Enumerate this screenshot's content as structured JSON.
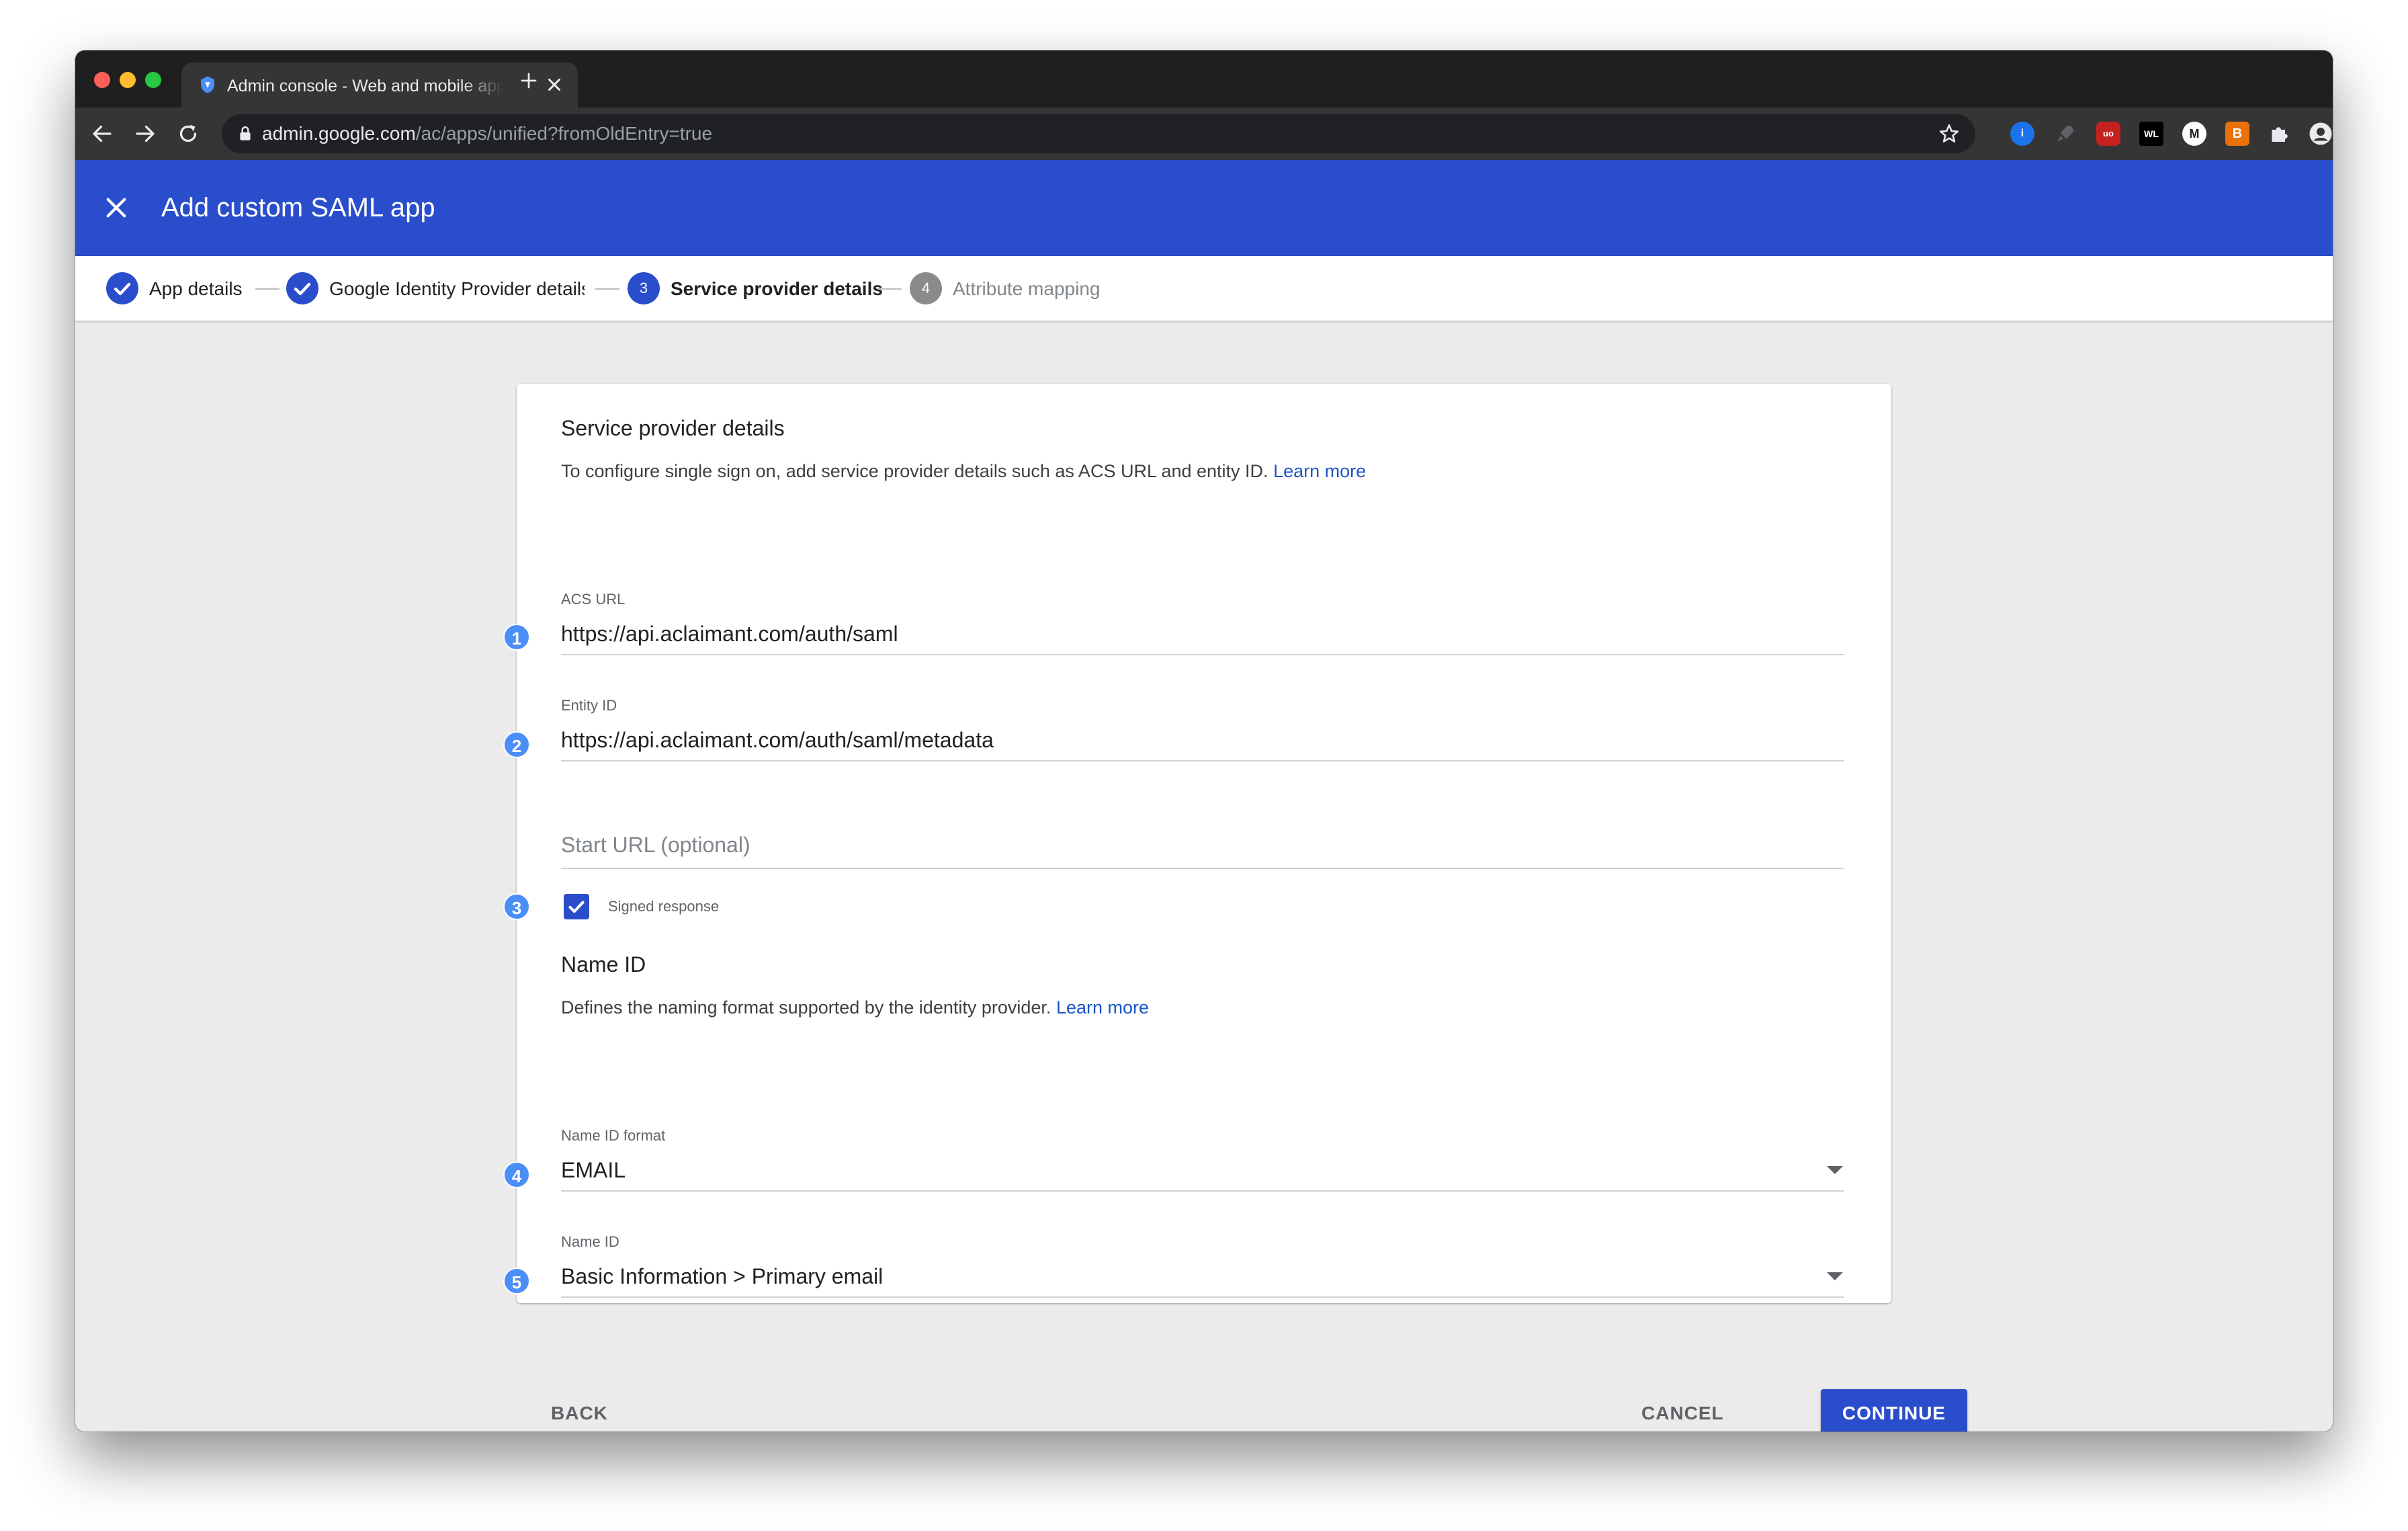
{
  "browser": {
    "tab_title": "Admin console - Web and mobile apps",
    "url_host": "admin.google.com",
    "url_path": "/ac/apps/unified?fromOldEntry=true",
    "extensions": [
      {
        "name": "1password-icon",
        "color": "#1a73e8",
        "text": "i"
      },
      {
        "name": "rocket-icon",
        "color": "#5f6368",
        "text": ""
      },
      {
        "name": "ublock-icon",
        "color": "#c5221f",
        "text": "uo"
      },
      {
        "name": "wappalyzer-icon",
        "color": "#000000",
        "text": "WL"
      },
      {
        "name": "medium-icon",
        "color": "#202124",
        "text": "M"
      },
      {
        "name": "brave-icon",
        "color": "#e8710a",
        "text": "B"
      },
      {
        "name": "puzzle-icon",
        "color": "#e8eaed",
        "text": ""
      }
    ]
  },
  "appbar": {
    "title": "Add custom SAML app"
  },
  "stepper": {
    "steps": [
      {
        "label": "App details",
        "state": "done"
      },
      {
        "label": "Google Identity Provider details",
        "state": "done"
      },
      {
        "label": "Service provider details",
        "number": "3",
        "state": "active"
      },
      {
        "label": "Attribute mapping",
        "number": "4",
        "state": "pending"
      }
    ]
  },
  "service_provider": {
    "title": "Service provider details",
    "description": "To configure single sign on, add service provider details such as ACS URL and entity ID.",
    "learn_more": "Learn more",
    "acs_url": {
      "label": "ACS URL",
      "value": "https://api.aclaimant.com/auth/saml",
      "badge": "1"
    },
    "entity_id": {
      "label": "Entity ID",
      "value": "https://api.aclaimant.com/auth/saml/metadata",
      "badge": "2"
    },
    "start_url": {
      "placeholder": "Start URL (optional)"
    },
    "signed_response": {
      "label": "Signed response",
      "checked": true,
      "badge": "3"
    }
  },
  "name_id": {
    "title": "Name ID",
    "description": "Defines the naming format supported by the identity provider.",
    "learn_more": "Learn more",
    "format": {
      "label": "Name ID format",
      "value": "EMAIL",
      "badge": "4"
    },
    "name_id": {
      "label": "Name ID",
      "value": "Basic Information > Primary email",
      "badge": "5"
    }
  },
  "footer": {
    "back": "BACK",
    "cancel": "CANCEL",
    "continue": "CONTINUE"
  },
  "colors": {
    "primary": "#2a4ecb",
    "badge": "#4c8ef7",
    "link": "#1a56c8"
  }
}
